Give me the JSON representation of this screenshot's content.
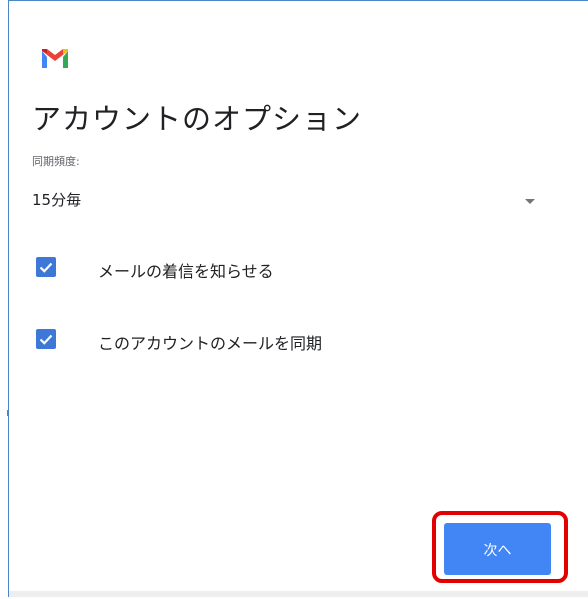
{
  "app": {
    "logo_icon": "gmail-m-icon",
    "colors": {
      "accent": "#4285f4",
      "checkbox": "#3d78d8",
      "highlight": "#e30000",
      "logo_red": "#ea4335",
      "logo_blue": "#4285f4",
      "logo_green": "#34a853",
      "logo_yellow": "#fbbc04"
    }
  },
  "page": {
    "title": "アカウントのオプション"
  },
  "sync": {
    "label": "同期頻度:",
    "value": "15分毎"
  },
  "options": [
    {
      "label": "メールの着信を知らせる",
      "checked": true
    },
    {
      "label": "このアカウントのメールを同期",
      "checked": true
    }
  ],
  "actions": {
    "next_label": "次へ"
  }
}
